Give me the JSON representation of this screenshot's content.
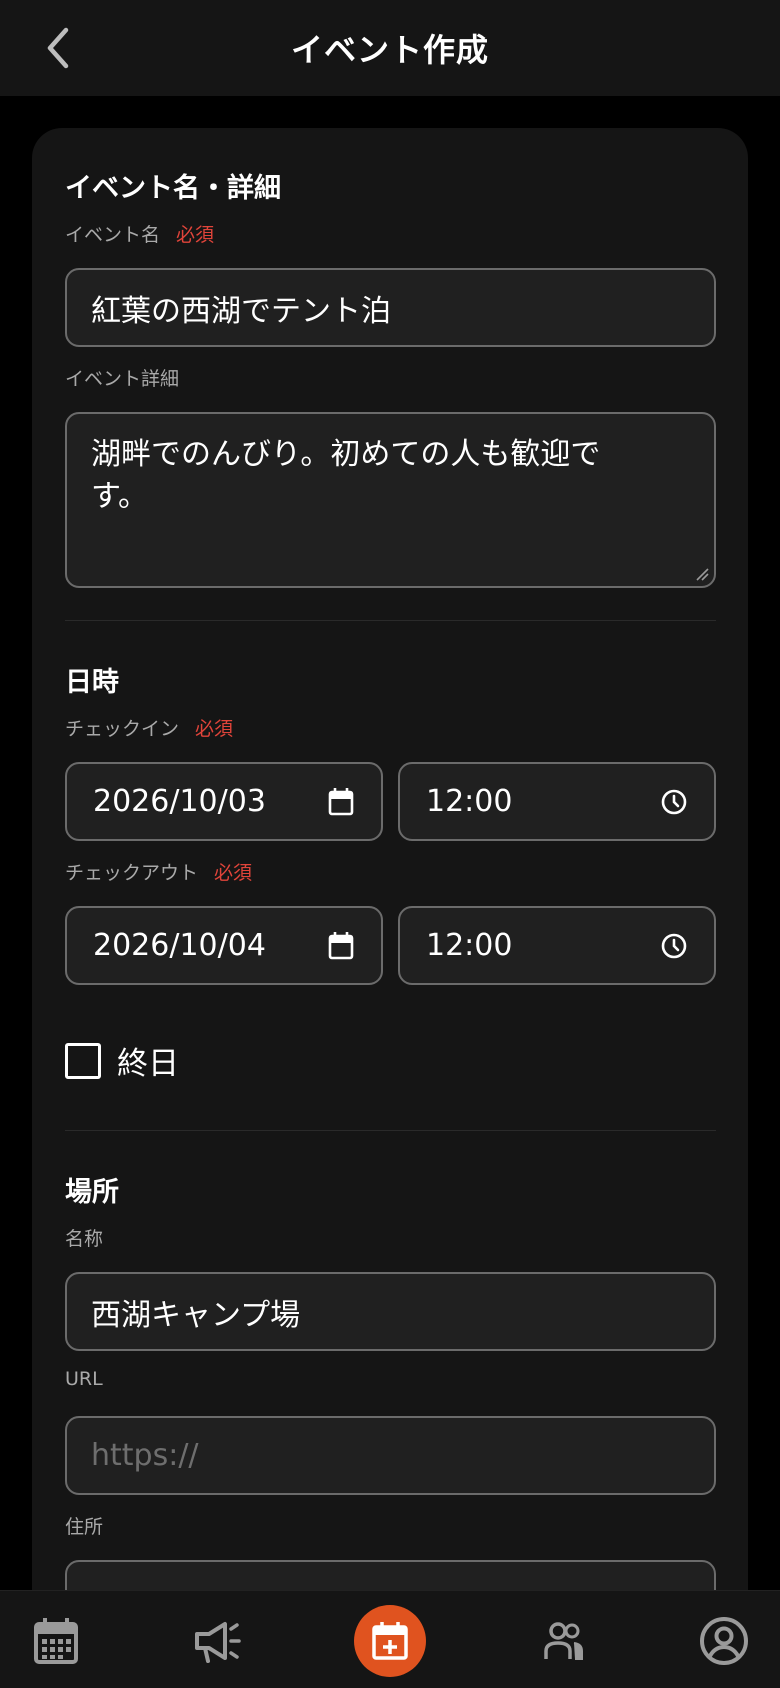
{
  "header": {
    "title": "イベント作成"
  },
  "sections": {
    "details": {
      "title": "イベント名・詳細",
      "event_name_label": "イベント名",
      "event_name_value": "紅葉の西湖でテント泊",
      "event_detail_label": "イベント詳細",
      "event_detail_value": "湖畔でのんびり。初めての人も歓迎です。"
    },
    "datetime": {
      "title": "日時",
      "checkin_label": "チェックイン",
      "checkin_date": "2026/10/03",
      "checkin_time": "12:00",
      "checkout_label": "チェックアウト",
      "checkout_date": "2026/10/04",
      "checkout_time": "12:00",
      "allday_label": "終日",
      "allday_checked": false
    },
    "place": {
      "title": "場所",
      "name_label": "名称",
      "name_value": "西湖キャンプ場",
      "url_label": "URL",
      "url_placeholder": "https://",
      "address_label": "住所"
    }
  },
  "required_label": "必須",
  "bottom_nav": [
    {
      "icon": "calendar-icon"
    },
    {
      "icon": "megaphone-icon"
    },
    {
      "icon": "calendar-add-icon",
      "active": true
    },
    {
      "icon": "people-icon"
    },
    {
      "icon": "account-circle-icon"
    }
  ],
  "colors": {
    "accent": "#e0531f",
    "required": "#e0443a",
    "background": "#000000",
    "card": "#151515"
  }
}
